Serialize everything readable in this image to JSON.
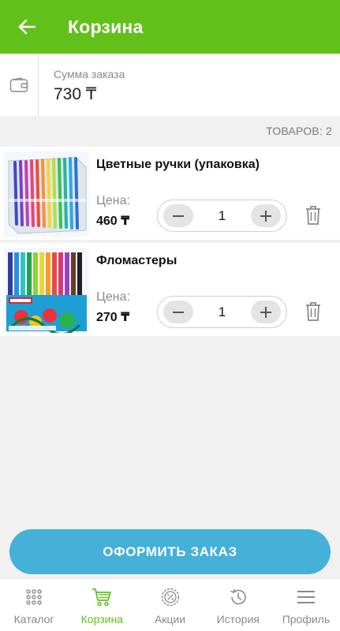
{
  "header": {
    "title": "Корзина"
  },
  "summary": {
    "label": "Сумма заказа",
    "value": "730 ₸"
  },
  "cart": {
    "count_label": "ТОВАРОВ: 2",
    "items": [
      {
        "name": "Цветные ручки (упаковка)",
        "price_label": "Цена:",
        "price": "460 ₸",
        "quantity": "1"
      },
      {
        "name": "Фломастеры",
        "price_label": "Цена:",
        "price": "270 ₸",
        "quantity": "1"
      }
    ]
  },
  "checkout": {
    "label": "ОФОРМИТЬ ЗАКАЗ"
  },
  "tabs": [
    {
      "label": "Каталог",
      "icon": "grid-dots-icon"
    },
    {
      "label": "Корзина",
      "icon": "cart-icon",
      "active": true
    },
    {
      "label": "Акции",
      "icon": "discount-badge-icon"
    },
    {
      "label": "История",
      "icon": "history-icon"
    },
    {
      "label": "Профиль",
      "icon": "menu-icon"
    }
  ],
  "colors": {
    "brand": "#62c01b",
    "accent": "#45b0d8",
    "background": "#f1f1f1"
  }
}
